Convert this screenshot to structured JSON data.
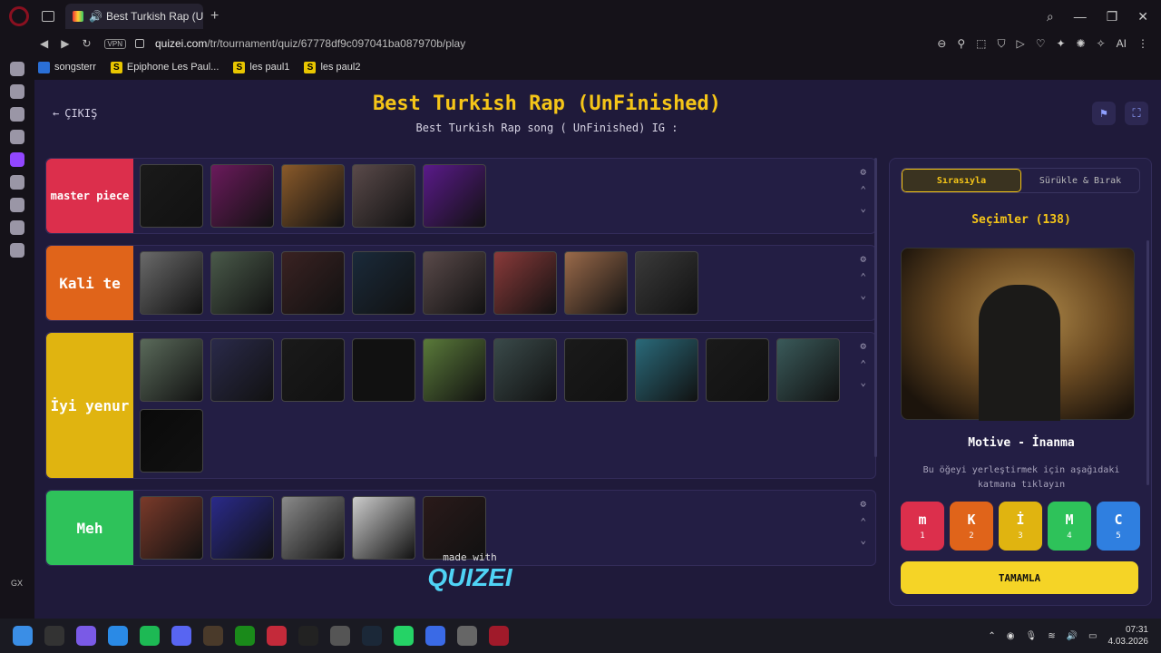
{
  "browser": {
    "tab_title": "Best Turkish Rap (UnFin",
    "url_domain": "quizei.com",
    "url_path": "/tr/tournament/quiz/67778df9c097041ba087970b/play",
    "vpn_label": "VPN",
    "sidebar_label": "GX",
    "right_tools_ai": "AI"
  },
  "bookmarks": [
    {
      "label": "songsterr",
      "icon": "g"
    },
    {
      "label": "Epiphone Les Paul...",
      "icon": "s"
    },
    {
      "label": "les paul1",
      "icon": "s"
    },
    {
      "label": "les paul2",
      "icon": "s"
    }
  ],
  "page": {
    "exit_label": "ÇIKIŞ",
    "title": "Best Turkish Rap (UnFinished)",
    "subtitle": "Best Turkish Rap song ( UnFinished) IG :"
  },
  "tiers": [
    {
      "label": "master piece",
      "color": "#dc2f4c",
      "thumbs": [
        "#1a1a1a",
        "#6b1a5c",
        "#8a5a2a",
        "#5a4a4a",
        "#5a1a8a"
      ]
    },
    {
      "label": "Kali te",
      "color": "#e0641a",
      "thumbs": [
        "#6a6a6a",
        "#4a5a4a",
        "#3a2222",
        "#1a2a3a",
        "#5a4a4a",
        "#8a3a3a",
        "#9a6a4a",
        "#3a3a3a"
      ]
    },
    {
      "label": "İyi yenur",
      "color": "#e0b410",
      "thumbs": [
        "#5a6a5a",
        "#2a2a4a",
        "#1a1a1a",
        "#111",
        "#5a7a3a",
        "#3a4a4a",
        "#1a1a1a",
        "#2a6a7a",
        "#1a1a1a",
        "#3a5a5a",
        "#0a0a0a"
      ]
    },
    {
      "label": "Meh",
      "color": "#2ec25a",
      "thumbs": [
        "#7a3a2a",
        "#2a2a8a",
        "#8a8a8a",
        "#cccccc",
        "#2a1a1a"
      ]
    }
  ],
  "made_with": {
    "text": "made with",
    "brand": "QUIZEI"
  },
  "panel": {
    "mode_ordered": "Sırasıyla",
    "mode_drag": "Sürükle & Bırak",
    "choices_label": "Seçimler (138)",
    "song_name": "Motive - İnanma",
    "hint": "Bu öğeyi yerleştirmek için aşağıdaki katmana tıklayın",
    "tier_buttons": [
      {
        "letter": "m",
        "num": "1",
        "color": "#dc2f4c"
      },
      {
        "letter": "K",
        "num": "2",
        "color": "#e0641a"
      },
      {
        "letter": "İ",
        "num": "3",
        "color": "#e0b410"
      },
      {
        "letter": "M",
        "num": "4",
        "color": "#2ec25a"
      },
      {
        "letter": "C",
        "num": "5",
        "color": "#2f7fe0"
      }
    ],
    "done_label": "TAMAMLA"
  },
  "taskbar": {
    "time": "07:31",
    "date": "4.03.2026"
  }
}
